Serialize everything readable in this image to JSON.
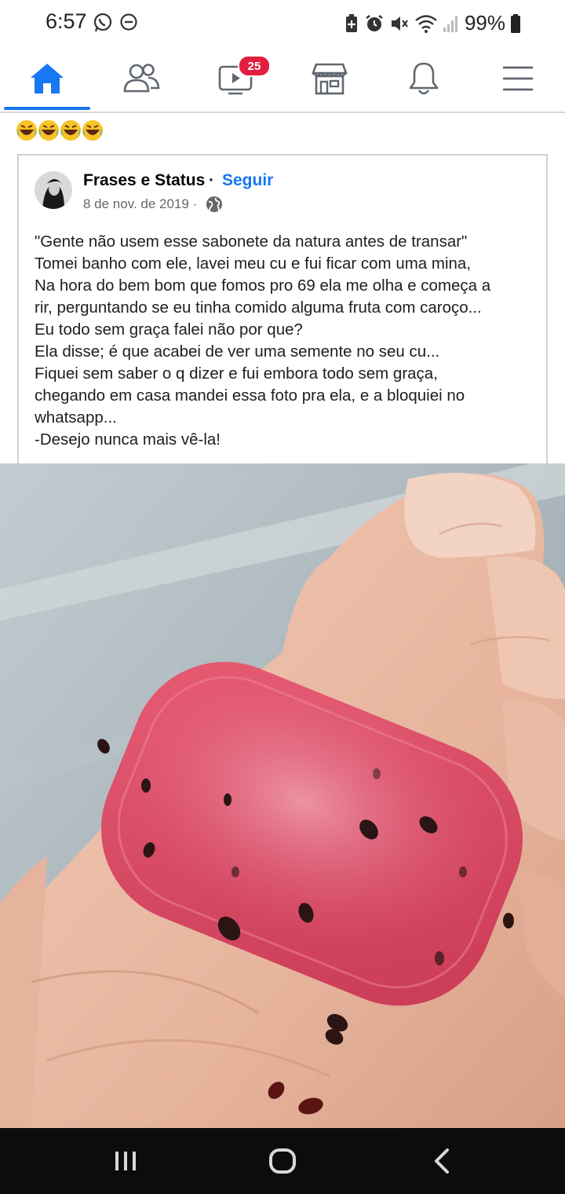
{
  "status_bar": {
    "time": "6:57",
    "battery": "99%",
    "icons": [
      "whatsapp-icon",
      "dnd-icon",
      "battery-saver-icon",
      "alarm-icon",
      "mute-icon",
      "wifi-icon",
      "signal-icon",
      "battery-icon"
    ]
  },
  "nav": {
    "items": [
      "home-icon",
      "friends-icon",
      "watch-icon",
      "marketplace-icon",
      "notifications-icon",
      "menu-icon"
    ],
    "watch_badge": "25",
    "accent": "#1877f2",
    "badge_color": "#e41e3f"
  },
  "caption": {
    "emojis": "😂😂😂😂"
  },
  "post": {
    "author": "Frases e Status",
    "separator": "·",
    "follow_label": "Seguir",
    "date": "8 de nov. de 2019",
    "date_separator": "·",
    "text": "\"Gente não usem esse sabonete da natura antes de transar\"\nTomei banho com ele, lavei meu cu e fui ficar com uma mina,\nNa hora do bem bom que fomos pro 69 ela me olha e começa a\nrir, perguntando se eu tinha comido alguma fruta com caroço...\nEu todo sem graça falei não por que?\nEla disse; é que acabei de ver uma semente no seu cu...\nFiquei sem saber o q dizer e fui embora todo sem graça,\nchegando em casa mandei essa foto pra ela, e a bloquiei no\nwhatsapp...\n-Desejo nunca mais vê-la!"
  },
  "system_nav": {
    "buttons": [
      "recents-icon",
      "home-button-icon",
      "back-icon"
    ]
  }
}
